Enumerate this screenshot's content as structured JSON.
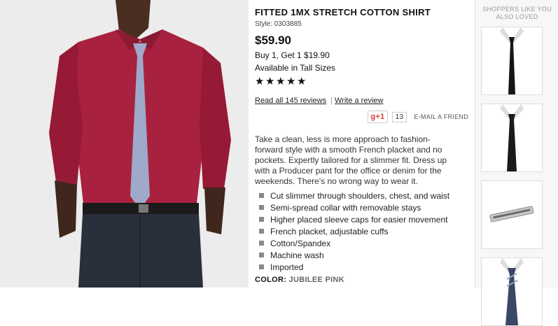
{
  "product": {
    "title": "FITTED 1MX STRETCH COTTON SHIRT",
    "style": "Style: 0303885",
    "price": "$59.90",
    "promo": "Buy 1, Get 1 $19.90",
    "tall": "Available in Tall Sizes",
    "rating": 5,
    "reviews_link": "Read all 145 reviews",
    "write_review": "Write a review",
    "gplus_label": "g+1",
    "gplus_count": "13",
    "email_label": "E-MAIL A FRIEND",
    "description": "Take a clean, less is more approach to fashion-forward style with a smooth French placket and no pockets. Expertly tailored for a slimmer fit. Dress up with a Producer pant for the office or denim for the weekends. There's no wrong way to wear it.",
    "features": [
      "Cut slimmer through shoulders, chest, and waist",
      "Semi-spread collar with removable stays",
      "Higher placed sleeve caps for easier movement",
      "French placket, adjustable cuffs",
      "Cotton/Spandex",
      "Machine wash",
      "Imported"
    ],
    "color_label": "COLOR:",
    "color_value": "JUBILEE PINK"
  },
  "sidebar": {
    "title": "SHOPPERS LIKE YOU ALSO LOVED"
  },
  "colors": {
    "shirt": "#a8213f",
    "tie": "#9fa9c9",
    "jeans": "#2a2f3c"
  }
}
